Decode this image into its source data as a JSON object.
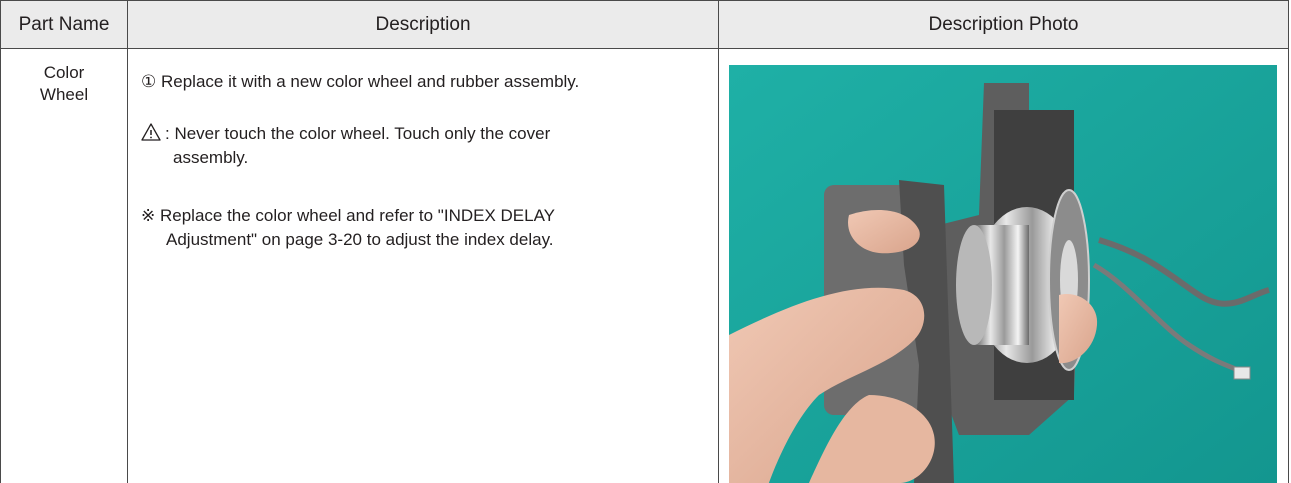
{
  "table": {
    "headers": {
      "part_name": "Part Name",
      "description": "Description",
      "photo": "Description Photo"
    },
    "row": {
      "part_name_line1": "Color",
      "part_name_line2": "Wheel",
      "step1_marker": "①",
      "step1_text": "Replace it with a new color wheel and rubber assembly.",
      "caution_line1": ": Never touch the color wheel. Touch only the cover",
      "caution_line2": "assembly.",
      "note_marker": "※",
      "note_line1": "Replace the color wheel and refer to \"INDEX DELAY",
      "note_line2": "Adjustment\" on page 3-20 to adjust the index delay."
    }
  },
  "colors": {
    "header_bg": "#ebebeb",
    "grid": "#4a4a4a",
    "photo_background": "#1aa59c"
  },
  "icons": {
    "caution": "warning-triangle-icon"
  }
}
